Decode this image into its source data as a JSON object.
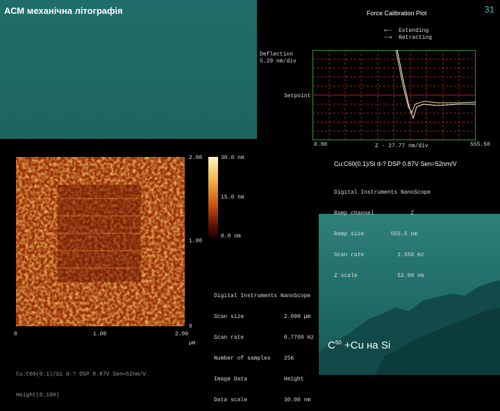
{
  "slide": {
    "title": "АСМ механічна літографія",
    "page_number": "31"
  },
  "force_plot": {
    "title": "Force Calibration Plot",
    "legend": [
      "Extending",
      "Retracting"
    ],
    "y_label_1": "Deflection",
    "y_label_2": "5.29 nm/div",
    "setpoint_label": "Setpoint",
    "x_min": "0.00",
    "x_max": "555.50",
    "x_label": "Z - 27.77 nm/div",
    "caption": "Cu:C60(0.1)/Si d-? DSP 0.87V Sen=52nm/V",
    "info": [
      "Digital Instruments NanoScope",
      "Ramp channel           Z",
      "Ramp size        555.5 nm",
      "Scan rate          1.550 Hz",
      "Z scale            52.90 nm"
    ]
  },
  "afm_image": {
    "y_ticks": [
      "2.00",
      "1.00",
      "0"
    ],
    "x_ticks": [
      "0",
      "1.00",
      "2.00"
    ],
    "x_unit": "µm",
    "colorbar_ticks": [
      "30.0 nm",
      "15.0 nm",
      "0.0 nm"
    ],
    "info": [
      "Digital Instruments NanoScope",
      "Scan size            2.000 µm",
      "Scan rate            0.7700 Hz",
      "Number of samples    256",
      "Image Data           Height",
      "Data scale           30.00 nm"
    ],
    "caption_lines": [
      "Cu:C60(0.1)/Si d-? DSP 0.87V Sen=52nm/V",
      "Height(0.100)"
    ]
  },
  "bottom_caption": {
    "c": "C",
    "sub": "60",
    "rest": " +Cu на Si"
  }
}
